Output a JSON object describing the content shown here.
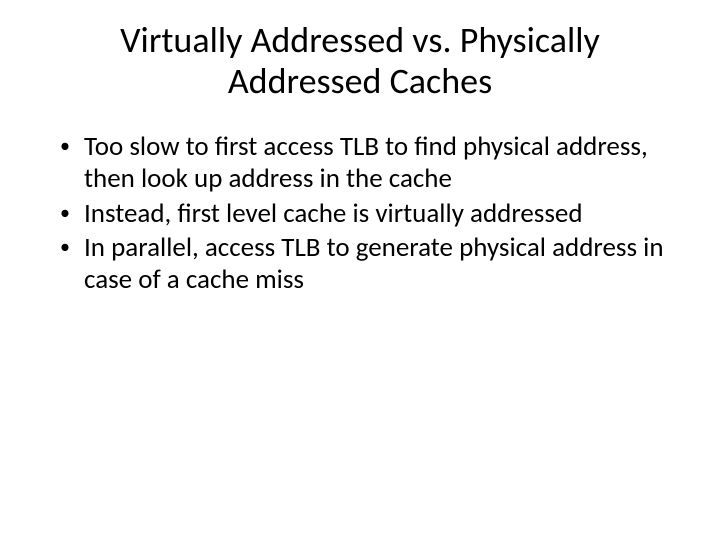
{
  "title": "Virtually Addressed vs. Physically Addressed Caches",
  "bullets": [
    "Too slow to first access TLB to find physical address, then look up address in the cache",
    "Instead, first level cache is virtually addressed",
    "In parallel, access TLB to generate physical address in case of a cache miss"
  ]
}
